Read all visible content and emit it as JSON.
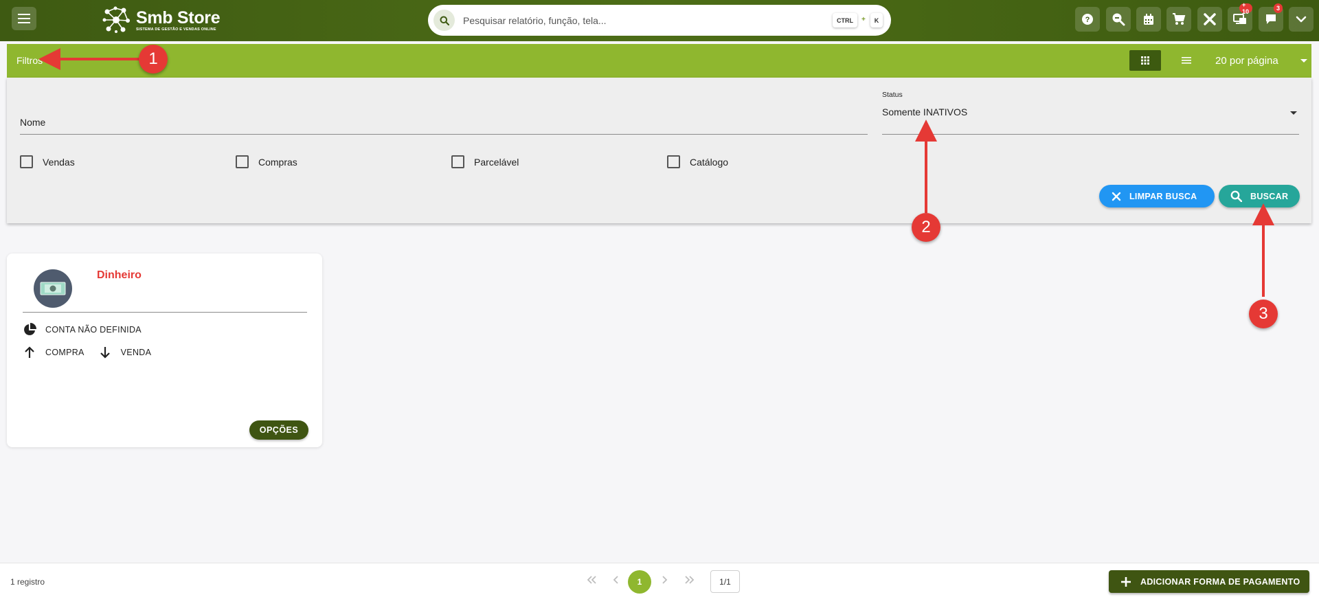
{
  "header": {
    "logo_title": "Smb Store",
    "logo_subtitle": "SISTEMA DE GESTÃO E VENDAS ONLINE",
    "search_placeholder": "Pesquisar relatório, função, tela...",
    "shortcut_ctrl": "CTRL",
    "shortcut_plus": "+",
    "shortcut_k": "K",
    "icons": [
      "help-icon",
      "zoom-search-icon",
      "calendar-icon",
      "cart-icon",
      "tools-icon",
      "screens-icon",
      "chat-icon",
      "chevron-down-icon"
    ],
    "badge_screens": "+ 10",
    "badge_chat": "3"
  },
  "filters": {
    "title": "Filtros",
    "per_page": "20 por página",
    "nome_label": "Nome",
    "status_label": "Status",
    "status_value": "Somente INATIVOS",
    "checkboxes": [
      "Vendas",
      "Compras",
      "Parcelável",
      "Catálogo"
    ],
    "clear_label": "LIMPAR BUSCA",
    "search_label": "BUSCAR"
  },
  "card": {
    "title": "Dinheiro",
    "account": "CONTA NÃO DEFINIDA",
    "purchase": "COMPRA",
    "sale": "VENDA",
    "options_label": "OPÇÕES"
  },
  "footer": {
    "count": "1 registro",
    "current_page": "1",
    "page_total": "1/1",
    "add_label": "ADICIONAR FORMA DE PAGAMENTO"
  },
  "annotations": [
    "1",
    "2",
    "3"
  ],
  "colors": {
    "header": "#4a6a16",
    "filterbar": "#8fb72f",
    "dark_green": "#3f5512",
    "clear_button": "#2196f3",
    "search_button": "#26a69a",
    "title_red": "#e53935",
    "annotation": "#e53935"
  }
}
